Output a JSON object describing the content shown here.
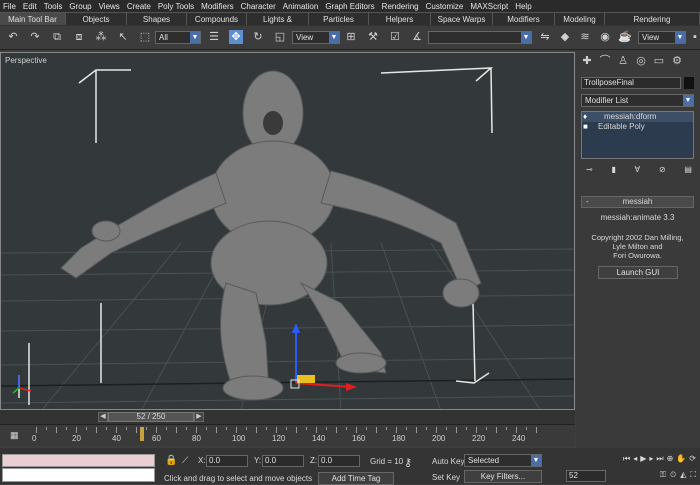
{
  "menu": [
    "File",
    "Edit",
    "Tools",
    "Group",
    "Views",
    "Create",
    "Poly Tools",
    "Modifiers",
    "Character",
    "Animation",
    "Graph Editors",
    "Rendering",
    "Customize",
    "MAXScript",
    "Help"
  ],
  "tabs": [
    "Main Tool Bar",
    "Objects",
    "Shapes",
    "Compounds",
    "Lights & Cameras",
    "Particles",
    "Helpers",
    "Space Warps",
    "Modifiers",
    "Modeling",
    "Rendering"
  ],
  "toolbar": {
    "filter_value": "All",
    "ref_coord": "View",
    "named_sel": "",
    "view_right": "View"
  },
  "viewport": {
    "label": "Perspective"
  },
  "panel": {
    "object_name": "TrollposeFinal",
    "modifier_list": "Modifier List",
    "stack": [
      "messiah:dform",
      "Editable Poly"
    ],
    "rollout_title": "messiah",
    "plugin_name": "messiah:animate 3.3",
    "copyright": [
      "Copyright 2002 Dan Milling,",
      "Lyle Milton and",
      "Fori Owurowa."
    ],
    "launch_label": "Launch GUI"
  },
  "timeline": {
    "frame_display": "52 / 250",
    "ticks": [
      "0",
      "20",
      "40",
      "60",
      "80",
      "100",
      "120",
      "140",
      "160",
      "180",
      "200",
      "220",
      "240"
    ],
    "current_frame": 52,
    "total_frames": 250
  },
  "status": {
    "x_label": "X:",
    "x_value": "0.0",
    "y_label": "Y:",
    "y_value": "0.0",
    "z_label": "Z:",
    "z_value": "0.0",
    "grid": "Grid = 10",
    "auto_key": "Auto Key",
    "selected": "Selected",
    "set_key": "Set Key",
    "key_filters": "Key Filters...",
    "prompt": "Click and drag to select and move objects",
    "add_time_tag": "Add Time Tag",
    "frame_field": "52"
  }
}
